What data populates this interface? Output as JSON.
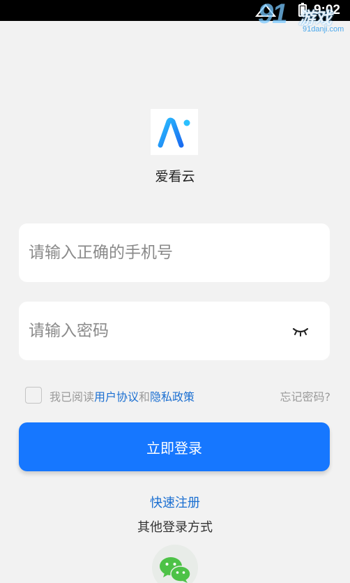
{
  "status_bar": {
    "time": "9:02"
  },
  "watermark": {
    "big": "91",
    "mid": "游戏",
    "small": "91danji.com"
  },
  "app": {
    "name": "爱看云"
  },
  "phone_input": {
    "value": "",
    "placeholder": "请输入正确的手机号"
  },
  "password_input": {
    "value": "",
    "placeholder": "请输入密码"
  },
  "agreement": {
    "prefix": "我已阅读",
    "user_agreement": "用户协议",
    "and": "和",
    "privacy_policy": "隐私政策",
    "checked": false
  },
  "forgot_password": "忘记密码?",
  "login_button": "立即登录",
  "register_link": "快速注册",
  "other_login_label": "其他登录方式",
  "icons": {
    "logo": "ai-logo-icon",
    "eye": "eye-closed-icon",
    "wechat": "wechat-icon",
    "battery": "battery-icon",
    "signal": "signal-icon"
  },
  "colors": {
    "accent": "#1677ff",
    "link": "#1b6fd1",
    "wechat": "#4dc247",
    "background": "#f2f2f2"
  }
}
